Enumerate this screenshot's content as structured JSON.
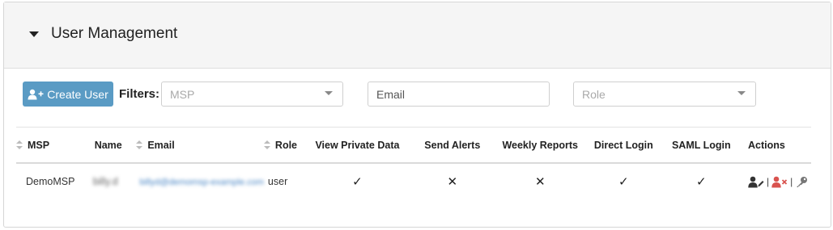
{
  "panel": {
    "title": "User Management"
  },
  "toolbar": {
    "create_label": "Create User",
    "filters_label": "Filters:",
    "msp_placeholder": "MSP",
    "email_placeholder": "Email",
    "role_placeholder": "Role"
  },
  "table": {
    "headers": {
      "msp": "MSP",
      "name": "Name",
      "email": "Email",
      "role": "Role",
      "view_private": "View Private Data",
      "send_alerts": "Send Alerts",
      "weekly_reports": "Weekly Reports",
      "direct_login": "Direct Login",
      "saml_login": "SAML Login",
      "actions": "Actions"
    },
    "rows": [
      {
        "msp": "DemoMSP",
        "name": "billy.d",
        "email": "billyd@demomsp-example.com",
        "role": "user",
        "view_private": "✓",
        "send_alerts": "✕",
        "weekly_reports": "✕",
        "direct_login": "✓",
        "saml_login": "✓",
        "action_separator": "|"
      }
    ]
  },
  "colors": {
    "primary": "#5a9bc4",
    "danger": "#d9534f",
    "header_bg": "#f5f5f5"
  },
  "icons": [
    "caret-down-icon",
    "user-plus-icon",
    "user-edit-icon",
    "user-remove-icon",
    "key-icon"
  ]
}
